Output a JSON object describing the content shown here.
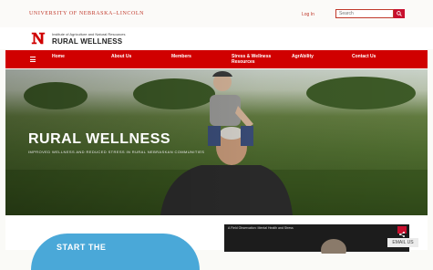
{
  "header": {
    "university": "UNIVERSITY of NEBRASKA–LINCOLN",
    "login": "Log In",
    "search_placeholder": "Search",
    "search_button_icon": "search-icon"
  },
  "brand": {
    "institute": "Institute of Agriculture and Natural Resources",
    "site_name": "RURAL WELLNESS"
  },
  "nav": {
    "items": [
      "Home",
      "About Us",
      "Members",
      "Stress & Wellness Resources",
      "AgrAbility",
      "Contact Us"
    ]
  },
  "hero": {
    "title": "RURAL WELLNESS",
    "subtitle": "IMPROVED WELLNESS AND REDUCED STRESS IN RURAL NEBRASKAN COMMUNITIES"
  },
  "cta": {
    "label": "START THE"
  },
  "video": {
    "title": "A Field Observation: Mental Health and Stress"
  },
  "email_button": "EMAIL US",
  "colors": {
    "brand_red": "#d00000",
    "accent_blue": "#4aa8d8"
  }
}
